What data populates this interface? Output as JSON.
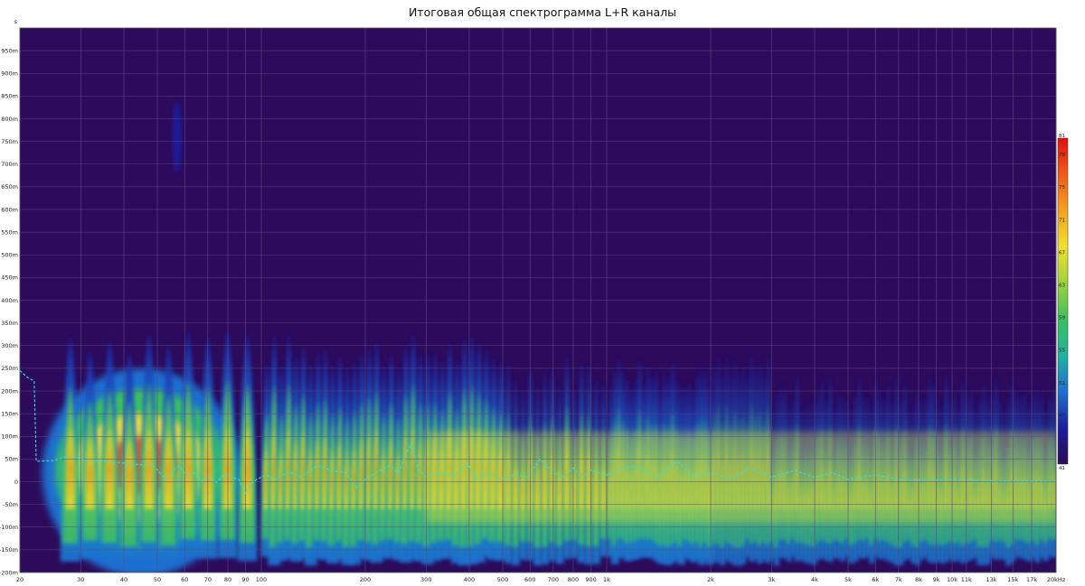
{
  "chart_data": {
    "type": "heatmap",
    "title": "Итоговая общая спектрограмма L+R каналы",
    "y_unit_label": "s",
    "x_scale": "log",
    "xlim_hz": [
      20,
      20000
    ],
    "ylim_ms": [
      -200,
      1000
    ],
    "x_ticks": [
      {
        "hz": 20,
        "label": "20"
      },
      {
        "hz": 30,
        "label": "30"
      },
      {
        "hz": 40,
        "label": "40"
      },
      {
        "hz": 50,
        "label": "50"
      },
      {
        "hz": 60,
        "label": "60"
      },
      {
        "hz": 70,
        "label": "70"
      },
      {
        "hz": 80,
        "label": "80"
      },
      {
        "hz": 90,
        "label": "90"
      },
      {
        "hz": 100,
        "label": "100"
      },
      {
        "hz": 200,
        "label": "200"
      },
      {
        "hz": 300,
        "label": "300"
      },
      {
        "hz": 400,
        "label": "400"
      },
      {
        "hz": 500,
        "label": "500"
      },
      {
        "hz": 600,
        "label": "600"
      },
      {
        "hz": 700,
        "label": "700"
      },
      {
        "hz": 800,
        "label": "800"
      },
      {
        "hz": 900,
        "label": "900"
      },
      {
        "hz": 1000,
        "label": "1k"
      },
      {
        "hz": 2000,
        "label": "2k"
      },
      {
        "hz": 3000,
        "label": "3k"
      },
      {
        "hz": 4000,
        "label": "4k"
      },
      {
        "hz": 5000,
        "label": "5k"
      },
      {
        "hz": 6000,
        "label": "6k"
      },
      {
        "hz": 7000,
        "label": "7k"
      },
      {
        "hz": 8000,
        "label": "8k"
      },
      {
        "hz": 9000,
        "label": "9k"
      },
      {
        "hz": 10000,
        "label": "10k"
      },
      {
        "hz": 11000,
        "label": "11k"
      },
      {
        "hz": 13000,
        "label": "13k"
      },
      {
        "hz": 15000,
        "label": "15k"
      },
      {
        "hz": 17000,
        "label": "17k"
      },
      {
        "hz": 20000,
        "label": "20kHz"
      }
    ],
    "y_ticks": [
      {
        "ms": -200,
        "label": "-200m"
      },
      {
        "ms": -150,
        "label": "-150m"
      },
      {
        "ms": -100,
        "label": "-100m"
      },
      {
        "ms": -50,
        "label": "-50m"
      },
      {
        "ms": 0,
        "label": "0"
      },
      {
        "ms": 50,
        "label": "50m"
      },
      {
        "ms": 100,
        "label": "100m"
      },
      {
        "ms": 150,
        "label": "150m"
      },
      {
        "ms": 200,
        "label": "200m"
      },
      {
        "ms": 250,
        "label": "250m"
      },
      {
        "ms": 300,
        "label": "300m"
      },
      {
        "ms": 350,
        "label": "350m"
      },
      {
        "ms": 400,
        "label": "400m"
      },
      {
        "ms": 450,
        "label": "450m"
      },
      {
        "ms": 500,
        "label": "500m"
      },
      {
        "ms": 550,
        "label": "550m"
      },
      {
        "ms": 600,
        "label": "600m"
      },
      {
        "ms": 650,
        "label": "650m"
      },
      {
        "ms": 700,
        "label": "700m"
      },
      {
        "ms": 750,
        "label": "750m"
      },
      {
        "ms": 800,
        "label": "800m"
      },
      {
        "ms": 850,
        "label": "850m"
      },
      {
        "ms": 900,
        "label": "900m"
      },
      {
        "ms": 950,
        "label": "950m"
      }
    ],
    "colorbar": {
      "range": [
        41,
        81
      ],
      "labels": [
        "81",
        "79",
        "75",
        "71",
        "67",
        "63",
        "59",
        "55",
        "51",
        "47",
        "43",
        "41"
      ],
      "colors": [
        "#2c0a5c",
        "#1b1fa0",
        "#1f6fd0",
        "#1fb3a0",
        "#3cc060",
        "#9ed23a",
        "#f0e030",
        "#f6a21e",
        "#f05a18",
        "#e01010"
      ]
    },
    "background_color": "#2c0b5c",
    "grid": true,
    "peak_time_series": {
      "color": "#35e0e0",
      "style": "dashed",
      "points": [
        [
          20,
          245
        ],
        [
          21,
          230
        ],
        [
          22,
          222
        ],
        [
          22.3,
          45
        ],
        [
          25,
          47
        ],
        [
          28,
          57
        ],
        [
          31,
          47
        ],
        [
          35,
          46
        ],
        [
          40,
          41
        ],
        [
          45,
          37
        ],
        [
          48,
          39
        ],
        [
          50,
          26
        ],
        [
          53,
          5
        ],
        [
          56,
          28
        ],
        [
          58,
          35
        ],
        [
          61,
          10
        ],
        [
          64,
          20
        ],
        [
          67,
          0
        ],
        [
          70,
          13
        ],
        [
          74,
          -2
        ],
        [
          78,
          15
        ],
        [
          82,
          10
        ],
        [
          86,
          5
        ],
        [
          90,
          -25
        ],
        [
          93,
          -5
        ],
        [
          97,
          5
        ],
        [
          103,
          15
        ],
        [
          110,
          5
        ],
        [
          120,
          22
        ],
        [
          130,
          10
        ],
        [
          145,
          35
        ],
        [
          160,
          25
        ],
        [
          175,
          20
        ],
        [
          190,
          -15
        ],
        [
          200,
          5
        ],
        [
          215,
          20
        ],
        [
          235,
          35
        ],
        [
          250,
          20
        ],
        [
          262,
          60
        ],
        [
          272,
          85
        ],
        [
          285,
          25
        ],
        [
          300,
          10
        ],
        [
          330,
          20
        ],
        [
          360,
          10
        ],
        [
          395,
          40
        ],
        [
          420,
          5
        ],
        [
          450,
          20
        ],
        [
          490,
          5
        ],
        [
          540,
          15
        ],
        [
          590,
          10
        ],
        [
          640,
          50
        ],
        [
          700,
          20
        ],
        [
          750,
          10
        ],
        [
          800,
          30
        ],
        [
          850,
          10
        ],
        [
          900,
          25
        ],
        [
          1000,
          15
        ],
        [
          1200,
          35
        ],
        [
          1400,
          10
        ],
        [
          1600,
          45
        ],
        [
          1800,
          10
        ],
        [
          2000,
          20
        ],
        [
          2300,
          5
        ],
        [
          2600,
          30
        ],
        [
          3000,
          10
        ],
        [
          3500,
          25
        ],
        [
          4000,
          10
        ],
        [
          4500,
          20
        ],
        [
          5000,
          5
        ],
        [
          6000,
          15
        ],
        [
          7000,
          5
        ],
        [
          8000,
          3
        ],
        [
          10000,
          4
        ],
        [
          13000,
          2
        ],
        [
          17000,
          1
        ],
        [
          20000,
          2
        ]
      ]
    }
  }
}
